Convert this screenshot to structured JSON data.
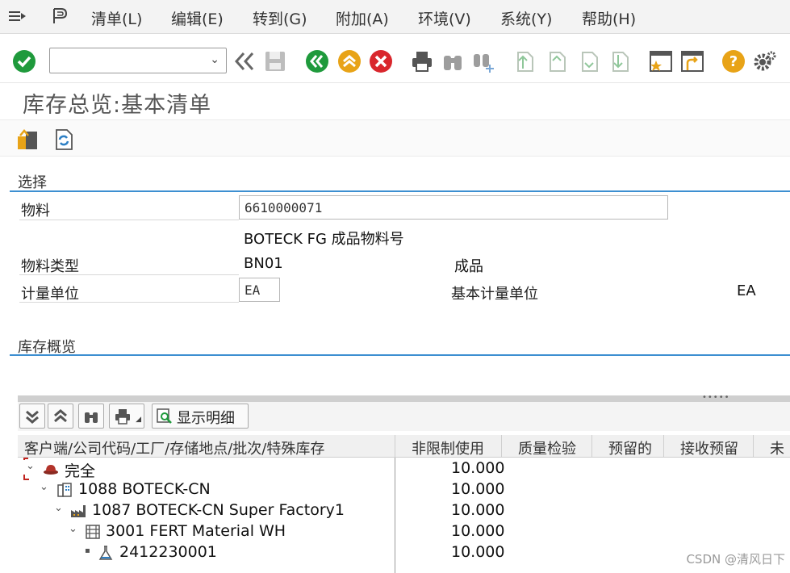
{
  "menu": [
    "清单(L)",
    "编辑(E)",
    "转到(G)",
    "附加(A)",
    "环境(V)",
    "系统(Y)",
    "帮助(H)"
  ],
  "command_field": {
    "value": ""
  },
  "page_title": "库存总览:基本清单",
  "selection": {
    "header": "选择",
    "material_label": "物料",
    "material_value": "6610000071",
    "material_desc": "BOTECK FG 成品物料号",
    "material_type_label": "物料类型",
    "material_type_value": "BN01",
    "material_type_desc": "成品",
    "uom_label": "计量单位",
    "uom_value": "EA",
    "base_uom_label": "基本计量单位",
    "base_uom_value": "EA"
  },
  "overview": {
    "header": "库存概览",
    "show_detail_label": "显示明细",
    "columns": [
      "客户端/公司代码/工厂/存储地点/批次/特殊库存",
      "非限制使用",
      "质量检验",
      "预留的",
      "接收预留",
      "未"
    ],
    "rows": [
      {
        "label": "完全",
        "qty": "10.000"
      },
      {
        "label": "1088 BOTECK-CN",
        "qty": "10.000"
      },
      {
        "label": "1087 BOTECK-CN Super Factory1",
        "qty": "10.000"
      },
      {
        "label": "3001 FERT Material WH",
        "qty": "10.000"
      },
      {
        "label": "2412230001",
        "qty": "10.000"
      }
    ]
  },
  "watermark": "CSDN @清风日下",
  "colors": {
    "accent_line": "#3d8fd1",
    "ok_green": "#1f9a3c",
    "cancel_red": "#d9262c",
    "nav_orange": "#e8a317"
  }
}
